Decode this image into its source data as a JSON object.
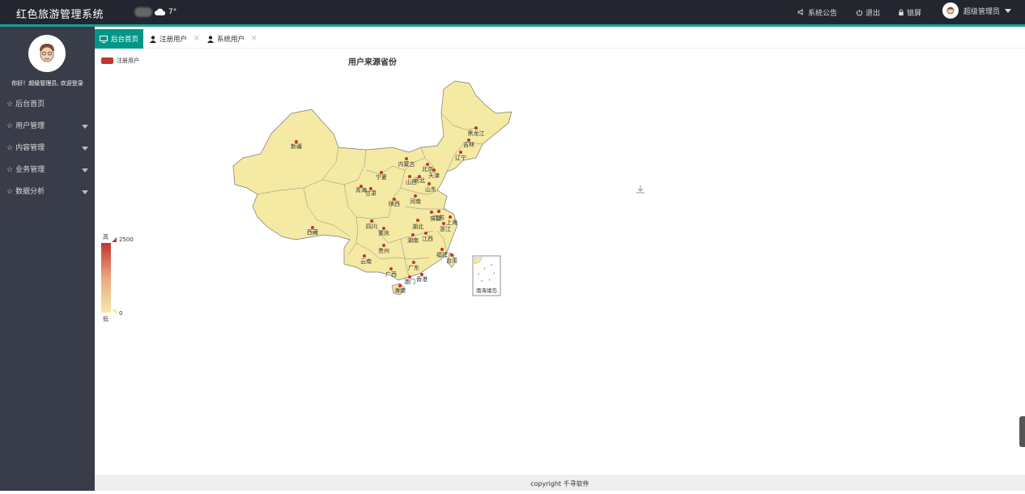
{
  "app": {
    "title": "红色旅游管理系统",
    "temperature": "7°"
  },
  "header": {
    "notice_label": "系统公告",
    "logout_label": "退出",
    "lock_label": "锁屏",
    "user_label": "超级管理员"
  },
  "sidebar": {
    "welcome": "你好！超级管理员, 欢迎登录",
    "items": [
      {
        "label": "后台首页"
      },
      {
        "label": "用户管理"
      },
      {
        "label": "内容管理"
      },
      {
        "label": "业务管理"
      },
      {
        "label": "数据分析"
      }
    ]
  },
  "tabs": [
    {
      "label": "后台首页",
      "icon": "monitor-icon"
    },
    {
      "label": "注册用户",
      "icon": "user-icon"
    },
    {
      "label": "系统用户",
      "icon": "user-icon"
    }
  ],
  "chart_data": {
    "type": "map",
    "title": "用户来源省份",
    "series": [
      {
        "name": "注册用户"
      }
    ],
    "visual_map": {
      "max": 2500,
      "min": 0,
      "high_label": "高",
      "low_label": "低"
    },
    "regions": [
      "新疆",
      "西藏",
      "青海",
      "甘肃",
      "宁夏",
      "内蒙古",
      "黑龙江",
      "吉林",
      "辽宁",
      "北京",
      "天津",
      "河北",
      "山西",
      "山东",
      "陕西",
      "河南",
      "四川",
      "重庆",
      "湖北",
      "安徽",
      "江苏",
      "上海",
      "浙江",
      "湖南",
      "江西",
      "贵州",
      "云南",
      "广西",
      "广东",
      "福建",
      "台湾",
      "海南",
      "澳门",
      "香港"
    ],
    "inset_label": "南海诸岛",
    "colors": {
      "land": "#f5eaa3",
      "border": "#777777",
      "point": "#c23531"
    }
  },
  "footer": {
    "copyright": "copyright 千寻软件"
  }
}
